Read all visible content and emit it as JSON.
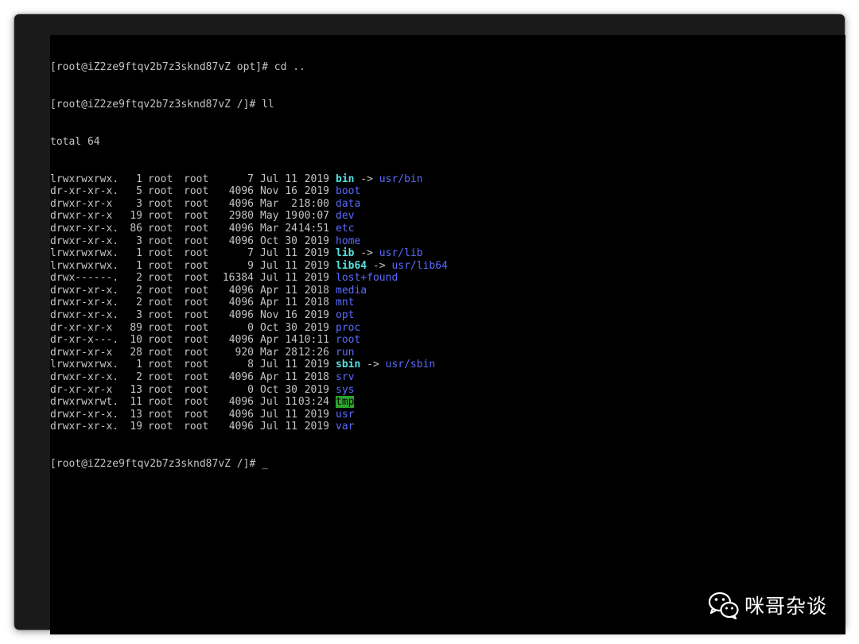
{
  "terminal": {
    "lines_before": [
      "[root@iZ2ze9ftqv2b7z3sknd87vZ opt]# cd ..",
      "[root@iZ2ze9ftqv2b7z3sknd87vZ /]# ll",
      "total 64"
    ],
    "listing": [
      {
        "perm": "lrwxrwxrwx.",
        "links": "1",
        "user": "root",
        "group": "root",
        "size": "7",
        "month": "Jul",
        "day": "11",
        "time": "2019",
        "name": "bin",
        "type": "link",
        "target": "usr/bin"
      },
      {
        "perm": "dr-xr-xr-x.",
        "links": "5",
        "user": "root",
        "group": "root",
        "size": "4096",
        "month": "Nov",
        "day": "16",
        "time": "2019",
        "name": "boot",
        "type": "dir",
        "target": ""
      },
      {
        "perm": "drwxr-xr-x",
        "links": "3",
        "user": "root",
        "group": "root",
        "size": "4096",
        "month": "Mar",
        "day": "2",
        "time": "18:00",
        "name": "data",
        "type": "dir",
        "target": ""
      },
      {
        "perm": "drwxr-xr-x",
        "links": "19",
        "user": "root",
        "group": "root",
        "size": "2980",
        "month": "May",
        "day": "19",
        "time": "00:07",
        "name": "dev",
        "type": "dir",
        "target": ""
      },
      {
        "perm": "drwxr-xr-x.",
        "links": "86",
        "user": "root",
        "group": "root",
        "size": "4096",
        "month": "Mar",
        "day": "24",
        "time": "14:51",
        "name": "etc",
        "type": "dir",
        "target": ""
      },
      {
        "perm": "drwxr-xr-x.",
        "links": "3",
        "user": "root",
        "group": "root",
        "size": "4096",
        "month": "Oct",
        "day": "30",
        "time": "2019",
        "name": "home",
        "type": "dir",
        "target": ""
      },
      {
        "perm": "lrwxrwxrwx.",
        "links": "1",
        "user": "root",
        "group": "root",
        "size": "7",
        "month": "Jul",
        "day": "11",
        "time": "2019",
        "name": "lib",
        "type": "link",
        "target": "usr/lib"
      },
      {
        "perm": "lrwxrwxrwx.",
        "links": "1",
        "user": "root",
        "group": "root",
        "size": "9",
        "month": "Jul",
        "day": "11",
        "time": "2019",
        "name": "lib64",
        "type": "link",
        "target": "usr/lib64"
      },
      {
        "perm": "drwx------.",
        "links": "2",
        "user": "root",
        "group": "root",
        "size": "16384",
        "month": "Jul",
        "day": "11",
        "time": "2019",
        "name": "lost+found",
        "type": "dir",
        "target": ""
      },
      {
        "perm": "drwxr-xr-x.",
        "links": "2",
        "user": "root",
        "group": "root",
        "size": "4096",
        "month": "Apr",
        "day": "11",
        "time": "2018",
        "name": "media",
        "type": "dir",
        "target": ""
      },
      {
        "perm": "drwxr-xr-x.",
        "links": "2",
        "user": "root",
        "group": "root",
        "size": "4096",
        "month": "Apr",
        "day": "11",
        "time": "2018",
        "name": "mnt",
        "type": "dir",
        "target": ""
      },
      {
        "perm": "drwxr-xr-x.",
        "links": "3",
        "user": "root",
        "group": "root",
        "size": "4096",
        "month": "Nov",
        "day": "16",
        "time": "2019",
        "name": "opt",
        "type": "dir",
        "target": ""
      },
      {
        "perm": "dr-xr-xr-x",
        "links": "89",
        "user": "root",
        "group": "root",
        "size": "0",
        "month": "Oct",
        "day": "30",
        "time": "2019",
        "name": "proc",
        "type": "dir",
        "target": ""
      },
      {
        "perm": "dr-xr-x---.",
        "links": "10",
        "user": "root",
        "group": "root",
        "size": "4096",
        "month": "Apr",
        "day": "14",
        "time": "10:11",
        "name": "root",
        "type": "dir",
        "target": ""
      },
      {
        "perm": "drwxr-xr-x",
        "links": "28",
        "user": "root",
        "group": "root",
        "size": "920",
        "month": "Mar",
        "day": "28",
        "time": "12:26",
        "name": "run",
        "type": "dir",
        "target": ""
      },
      {
        "perm": "lrwxrwxrwx.",
        "links": "1",
        "user": "root",
        "group": "root",
        "size": "8",
        "month": "Jul",
        "day": "11",
        "time": "2019",
        "name": "sbin",
        "type": "link",
        "target": "usr/sbin"
      },
      {
        "perm": "drwxr-xr-x.",
        "links": "2",
        "user": "root",
        "group": "root",
        "size": "4096",
        "month": "Apr",
        "day": "11",
        "time": "2018",
        "name": "srv",
        "type": "dir",
        "target": ""
      },
      {
        "perm": "dr-xr-xr-x",
        "links": "13",
        "user": "root",
        "group": "root",
        "size": "0",
        "month": "Oct",
        "day": "30",
        "time": "2019",
        "name": "sys",
        "type": "dir",
        "target": ""
      },
      {
        "perm": "drwxrwxrwt.",
        "links": "11",
        "user": "root",
        "group": "root",
        "size": "4096",
        "month": "Jul",
        "day": "11",
        "time": "03:24",
        "name": "tmp",
        "type": "sticky",
        "target": ""
      },
      {
        "perm": "drwxr-xr-x.",
        "links": "13",
        "user": "root",
        "group": "root",
        "size": "4096",
        "month": "Jul",
        "day": "11",
        "time": "2019",
        "name": "usr",
        "type": "dir",
        "target": ""
      },
      {
        "perm": "drwxr-xr-x.",
        "links": "19",
        "user": "root",
        "group": "root",
        "size": "4096",
        "month": "Jul",
        "day": "11",
        "time": "2019",
        "name": "var",
        "type": "dir",
        "target": ""
      }
    ],
    "arrow": "->",
    "final_prompt": "[root@iZ2ze9ftqv2b7z3sknd87vZ /]# ",
    "cursor": "_"
  },
  "watermark": {
    "text": "咪哥杂谈",
    "icon": "wechat-icon"
  },
  "colors": {
    "terminal_text": "#c4c4c4",
    "directory": "#5a6aff",
    "symlink": "#55e0e0",
    "sticky_bg": "#2aa52a",
    "screen_bg": "#000000"
  }
}
